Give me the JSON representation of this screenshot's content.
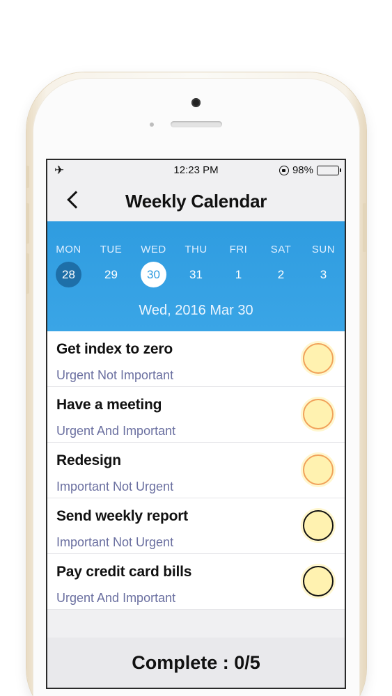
{
  "status_bar": {
    "time": "12:23 PM",
    "battery": "98%"
  },
  "nav": {
    "title": "Weekly Calendar"
  },
  "week": {
    "days": [
      {
        "name": "MON",
        "num": "28",
        "state": "today"
      },
      {
        "name": "TUE",
        "num": "29",
        "state": ""
      },
      {
        "name": "WED",
        "num": "30",
        "state": "selected"
      },
      {
        "name": "THU",
        "num": "31",
        "state": ""
      },
      {
        "name": "FRI",
        "num": "1",
        "state": ""
      },
      {
        "name": "SAT",
        "num": "2",
        "state": ""
      },
      {
        "name": "SUN",
        "num": "3",
        "state": ""
      }
    ],
    "selected_date": "Wed, 2016 Mar 30"
  },
  "tasks": [
    {
      "title": "Get index to zero",
      "priority": "Urgent Not Important"
    },
    {
      "title": "Have a meeting",
      "priority": "Urgent And Important"
    },
    {
      "title": "Redesign",
      "priority": "Important Not Urgent"
    },
    {
      "title": "Send weekly report",
      "priority": "Important Not Urgent"
    },
    {
      "title": "Pay credit card bills",
      "priority": "Urgent And Important"
    }
  ],
  "footer": {
    "complete_label": "Complete : 0/5"
  },
  "colors": {
    "header_blue": "#2f9ce0",
    "today_circle": "#1e6fa8",
    "check_fill": "#fff2b0",
    "check_orange": "#f1a25a"
  }
}
